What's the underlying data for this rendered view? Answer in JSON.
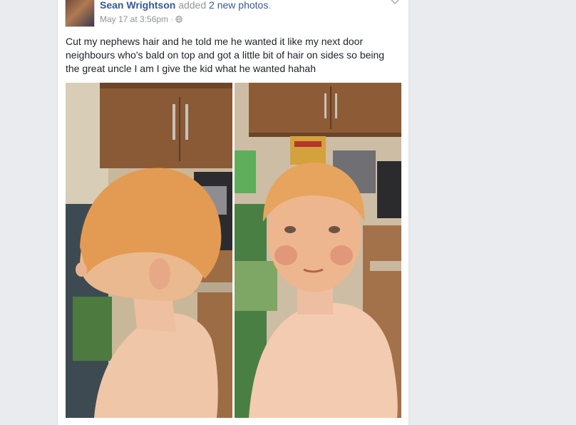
{
  "post": {
    "author": "Sean Wrightson",
    "action": "added",
    "photos_link": "2 new photos",
    "timestamp": "May 17 at 3:56pm",
    "separator": "·",
    "privacy_icon": "globe-icon",
    "text": "Cut my nephews hair and he told me he wanted it like my next door neighbours who's bald on top and got a little bit of hair on sides so being the great uncle I am I give the kid what he wanted hahah",
    "photos": [
      {
        "name": "post-photo-side-view"
      },
      {
        "name": "post-photo-front-view"
      }
    ]
  },
  "colors": {
    "link": "#365899",
    "meta": "#90949c",
    "text": "#1d2129",
    "page_bg": "#e9ebee"
  }
}
